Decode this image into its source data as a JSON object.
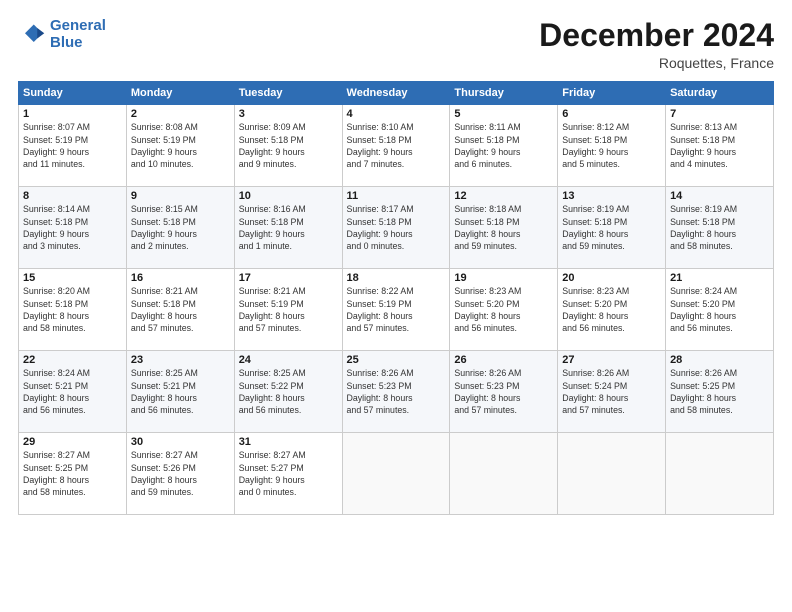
{
  "header": {
    "logo_line1": "General",
    "logo_line2": "Blue",
    "month": "December 2024",
    "location": "Roquettes, France"
  },
  "columns": [
    "Sunday",
    "Monday",
    "Tuesday",
    "Wednesday",
    "Thursday",
    "Friday",
    "Saturday"
  ],
  "weeks": [
    [
      {
        "day": "1",
        "info": "Sunrise: 8:07 AM\nSunset: 5:19 PM\nDaylight: 9 hours\nand 11 minutes."
      },
      {
        "day": "2",
        "info": "Sunrise: 8:08 AM\nSunset: 5:19 PM\nDaylight: 9 hours\nand 10 minutes."
      },
      {
        "day": "3",
        "info": "Sunrise: 8:09 AM\nSunset: 5:18 PM\nDaylight: 9 hours\nand 9 minutes."
      },
      {
        "day": "4",
        "info": "Sunrise: 8:10 AM\nSunset: 5:18 PM\nDaylight: 9 hours\nand 7 minutes."
      },
      {
        "day": "5",
        "info": "Sunrise: 8:11 AM\nSunset: 5:18 PM\nDaylight: 9 hours\nand 6 minutes."
      },
      {
        "day": "6",
        "info": "Sunrise: 8:12 AM\nSunset: 5:18 PM\nDaylight: 9 hours\nand 5 minutes."
      },
      {
        "day": "7",
        "info": "Sunrise: 8:13 AM\nSunset: 5:18 PM\nDaylight: 9 hours\nand 4 minutes."
      }
    ],
    [
      {
        "day": "8",
        "info": "Sunrise: 8:14 AM\nSunset: 5:18 PM\nDaylight: 9 hours\nand 3 minutes."
      },
      {
        "day": "9",
        "info": "Sunrise: 8:15 AM\nSunset: 5:18 PM\nDaylight: 9 hours\nand 2 minutes."
      },
      {
        "day": "10",
        "info": "Sunrise: 8:16 AM\nSunset: 5:18 PM\nDaylight: 9 hours\nand 1 minute."
      },
      {
        "day": "11",
        "info": "Sunrise: 8:17 AM\nSunset: 5:18 PM\nDaylight: 9 hours\nand 0 minutes."
      },
      {
        "day": "12",
        "info": "Sunrise: 8:18 AM\nSunset: 5:18 PM\nDaylight: 8 hours\nand 59 minutes."
      },
      {
        "day": "13",
        "info": "Sunrise: 8:19 AM\nSunset: 5:18 PM\nDaylight: 8 hours\nand 59 minutes."
      },
      {
        "day": "14",
        "info": "Sunrise: 8:19 AM\nSunset: 5:18 PM\nDaylight: 8 hours\nand 58 minutes."
      }
    ],
    [
      {
        "day": "15",
        "info": "Sunrise: 8:20 AM\nSunset: 5:18 PM\nDaylight: 8 hours\nand 58 minutes."
      },
      {
        "day": "16",
        "info": "Sunrise: 8:21 AM\nSunset: 5:18 PM\nDaylight: 8 hours\nand 57 minutes."
      },
      {
        "day": "17",
        "info": "Sunrise: 8:21 AM\nSunset: 5:19 PM\nDaylight: 8 hours\nand 57 minutes."
      },
      {
        "day": "18",
        "info": "Sunrise: 8:22 AM\nSunset: 5:19 PM\nDaylight: 8 hours\nand 57 minutes."
      },
      {
        "day": "19",
        "info": "Sunrise: 8:23 AM\nSunset: 5:20 PM\nDaylight: 8 hours\nand 56 minutes."
      },
      {
        "day": "20",
        "info": "Sunrise: 8:23 AM\nSunset: 5:20 PM\nDaylight: 8 hours\nand 56 minutes."
      },
      {
        "day": "21",
        "info": "Sunrise: 8:24 AM\nSunset: 5:20 PM\nDaylight: 8 hours\nand 56 minutes."
      }
    ],
    [
      {
        "day": "22",
        "info": "Sunrise: 8:24 AM\nSunset: 5:21 PM\nDaylight: 8 hours\nand 56 minutes."
      },
      {
        "day": "23",
        "info": "Sunrise: 8:25 AM\nSunset: 5:21 PM\nDaylight: 8 hours\nand 56 minutes."
      },
      {
        "day": "24",
        "info": "Sunrise: 8:25 AM\nSunset: 5:22 PM\nDaylight: 8 hours\nand 56 minutes."
      },
      {
        "day": "25",
        "info": "Sunrise: 8:26 AM\nSunset: 5:23 PM\nDaylight: 8 hours\nand 57 minutes."
      },
      {
        "day": "26",
        "info": "Sunrise: 8:26 AM\nSunset: 5:23 PM\nDaylight: 8 hours\nand 57 minutes."
      },
      {
        "day": "27",
        "info": "Sunrise: 8:26 AM\nSunset: 5:24 PM\nDaylight: 8 hours\nand 57 minutes."
      },
      {
        "day": "28",
        "info": "Sunrise: 8:26 AM\nSunset: 5:25 PM\nDaylight: 8 hours\nand 58 minutes."
      }
    ],
    [
      {
        "day": "29",
        "info": "Sunrise: 8:27 AM\nSunset: 5:25 PM\nDaylight: 8 hours\nand 58 minutes."
      },
      {
        "day": "30",
        "info": "Sunrise: 8:27 AM\nSunset: 5:26 PM\nDaylight: 8 hours\nand 59 minutes."
      },
      {
        "day": "31",
        "info": "Sunrise: 8:27 AM\nSunset: 5:27 PM\nDaylight: 9 hours\nand 0 minutes."
      },
      {
        "day": "",
        "info": ""
      },
      {
        "day": "",
        "info": ""
      },
      {
        "day": "",
        "info": ""
      },
      {
        "day": "",
        "info": ""
      }
    ]
  ]
}
